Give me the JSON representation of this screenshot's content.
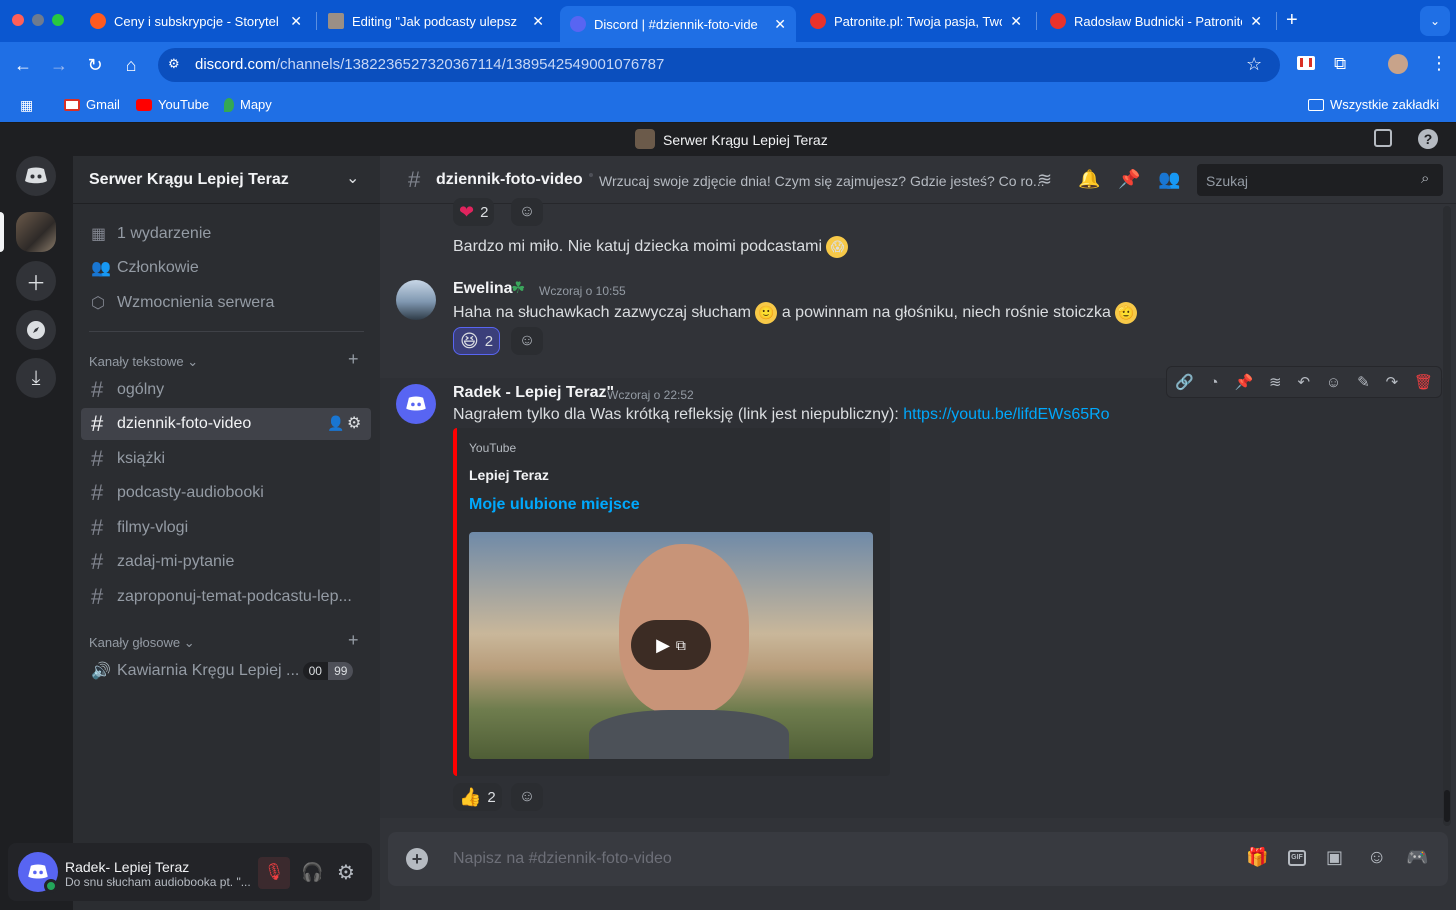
{
  "browser": {
    "tabs": [
      {
        "title": "Ceny i subskrypcje - Storytel",
        "fav_color": "#ff5a1f"
      },
      {
        "title": "Editing \"Jak podcasty ulepsz",
        "fav_color": "#888888"
      },
      {
        "title": "Discord | #dziennik-foto-vide",
        "fav_color": "#5865f2"
      },
      {
        "title": "Patronite.pl: Twoja pasja, Two",
        "fav_color": "#e8322b"
      },
      {
        "title": "Radosław Budnicki - Patronite",
        "fav_color": "#e8322b"
      }
    ],
    "new_tab": "+",
    "url_host": "discord.com",
    "url_path": "/channels/1382236527320367114/1389542549001076787",
    "bookmarks": [
      "Gmail",
      "YouTube",
      "Mapy"
    ],
    "all_bookmarks": "Wszystkie zakładki"
  },
  "discord": {
    "title": "Serwer Krągu Lepiej Teraz",
    "server_name": "Serwer Krągu Lepiej Teraz",
    "menu": [
      "1 wydarzenie",
      "Członkowie",
      "Wzmocnienia serwera"
    ],
    "text_category": "Kanały tekstowe",
    "text_channels": [
      "ogólny",
      "dziennik-foto-video",
      "książki",
      "podcasty-audiobooki",
      "filmy-vlogi",
      "zadaj-mi-pytanie",
      "zaproponuj-temat-podcastu-lep..."
    ],
    "voice_category": "Kanały głosowe",
    "voice_channel": "Kawiarnia Kręgu Lepiej ...",
    "voice_counts": [
      "00",
      "99"
    ],
    "user": {
      "name": "Radek- Lepiej Teraz",
      "status": "Do snu słucham audiobooka pt. \"..."
    },
    "channel": {
      "name": "dziennik-foto-video",
      "topic": "Wrzucaj swoje zdjęcie dnia! Czym się zajmujesz? Gdzie jesteś? Co ro...",
      "search_placeholder": "Szukaj"
    },
    "messages": {
      "top_reaction_count": "2",
      "m1_text": "Bardzo mi miło. Nie katuj dziecka moimi podcastami",
      "m2_author": "Ewelina",
      "m2_time": "Wczoraj o 10:55",
      "m2_text_a": "Haha na słuchawkach zazwyczaj słucham",
      "m2_text_b": "a powinnam na głośniku, niech rośnie stoiczka",
      "m2_reaction_count": "2",
      "m3_author": "Radek - Lepiej Teraz\"",
      "m3_time": "Wczoraj o 22:52",
      "m3_text": "Nagrałem tylko dla Was krótką refleksję (link jest niepubliczny):",
      "m3_link": "https://youtu.be/lifdEWs65Ro",
      "embed_provider": "YouTube",
      "embed_author": "Lepiej Teraz",
      "embed_title": "Moje ulubione miejsce",
      "m3_reaction_count": "2"
    },
    "composer_placeholder": "Napisz na #dziennik-foto-video"
  },
  "colors": {
    "blurple": "#5865f2",
    "link": "#00a8fc",
    "embed_bar": "#ff0000",
    "chrome_blue": "#1f6fe5"
  }
}
